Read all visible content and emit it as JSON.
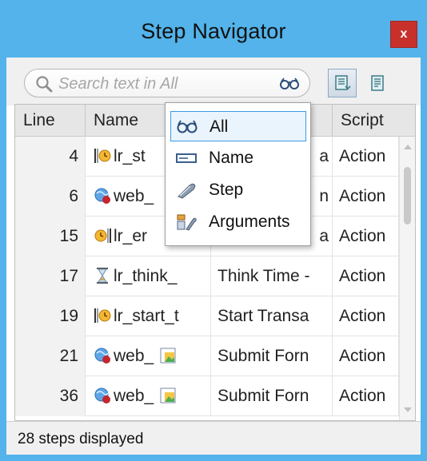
{
  "window": {
    "title": "Step Navigator",
    "close_label": "x"
  },
  "search": {
    "placeholder": "Search text in All"
  },
  "columns": [
    "Line",
    "Name",
    "",
    "Script"
  ],
  "rows": [
    {
      "line": "4",
      "name": "lr_st",
      "step": "a",
      "script": "Action",
      "icon": "transaction-icon"
    },
    {
      "line": "6",
      "name": "web_",
      "step": "n",
      "script": "Action",
      "icon": "web-icon"
    },
    {
      "line": "15",
      "name": "lr_er",
      "step": "a",
      "script": "Action",
      "icon": "end-transaction-icon"
    },
    {
      "line": "17",
      "name": "lr_think_",
      "step": "Think Time -",
      "script": "Action",
      "icon": "hourglass-icon"
    },
    {
      "line": "19",
      "name": "lr_start_t",
      "step": "Start Transa",
      "script": "Action",
      "icon": "transaction-icon"
    },
    {
      "line": "21",
      "name": "web_",
      "step": "Submit Forn",
      "script": "Action",
      "icon": "web-icon"
    },
    {
      "line": "36",
      "name": "web_",
      "step": "Submit Forn",
      "script": "Action",
      "icon": "web-icon"
    }
  ],
  "filter_menu": {
    "items": [
      {
        "label": "All",
        "icon": "glasses-icon",
        "selected": true
      },
      {
        "label": "Name",
        "icon": "name-field-icon",
        "selected": false
      },
      {
        "label": "Step",
        "icon": "step-icon",
        "selected": false
      },
      {
        "label": "Arguments",
        "icon": "arguments-icon",
        "selected": false
      }
    ]
  },
  "status": {
    "text": "28 steps displayed"
  },
  "colors": {
    "title_bar": "#53b3ea",
    "close_button": "#c8312b",
    "selection": "#3c9be6"
  }
}
